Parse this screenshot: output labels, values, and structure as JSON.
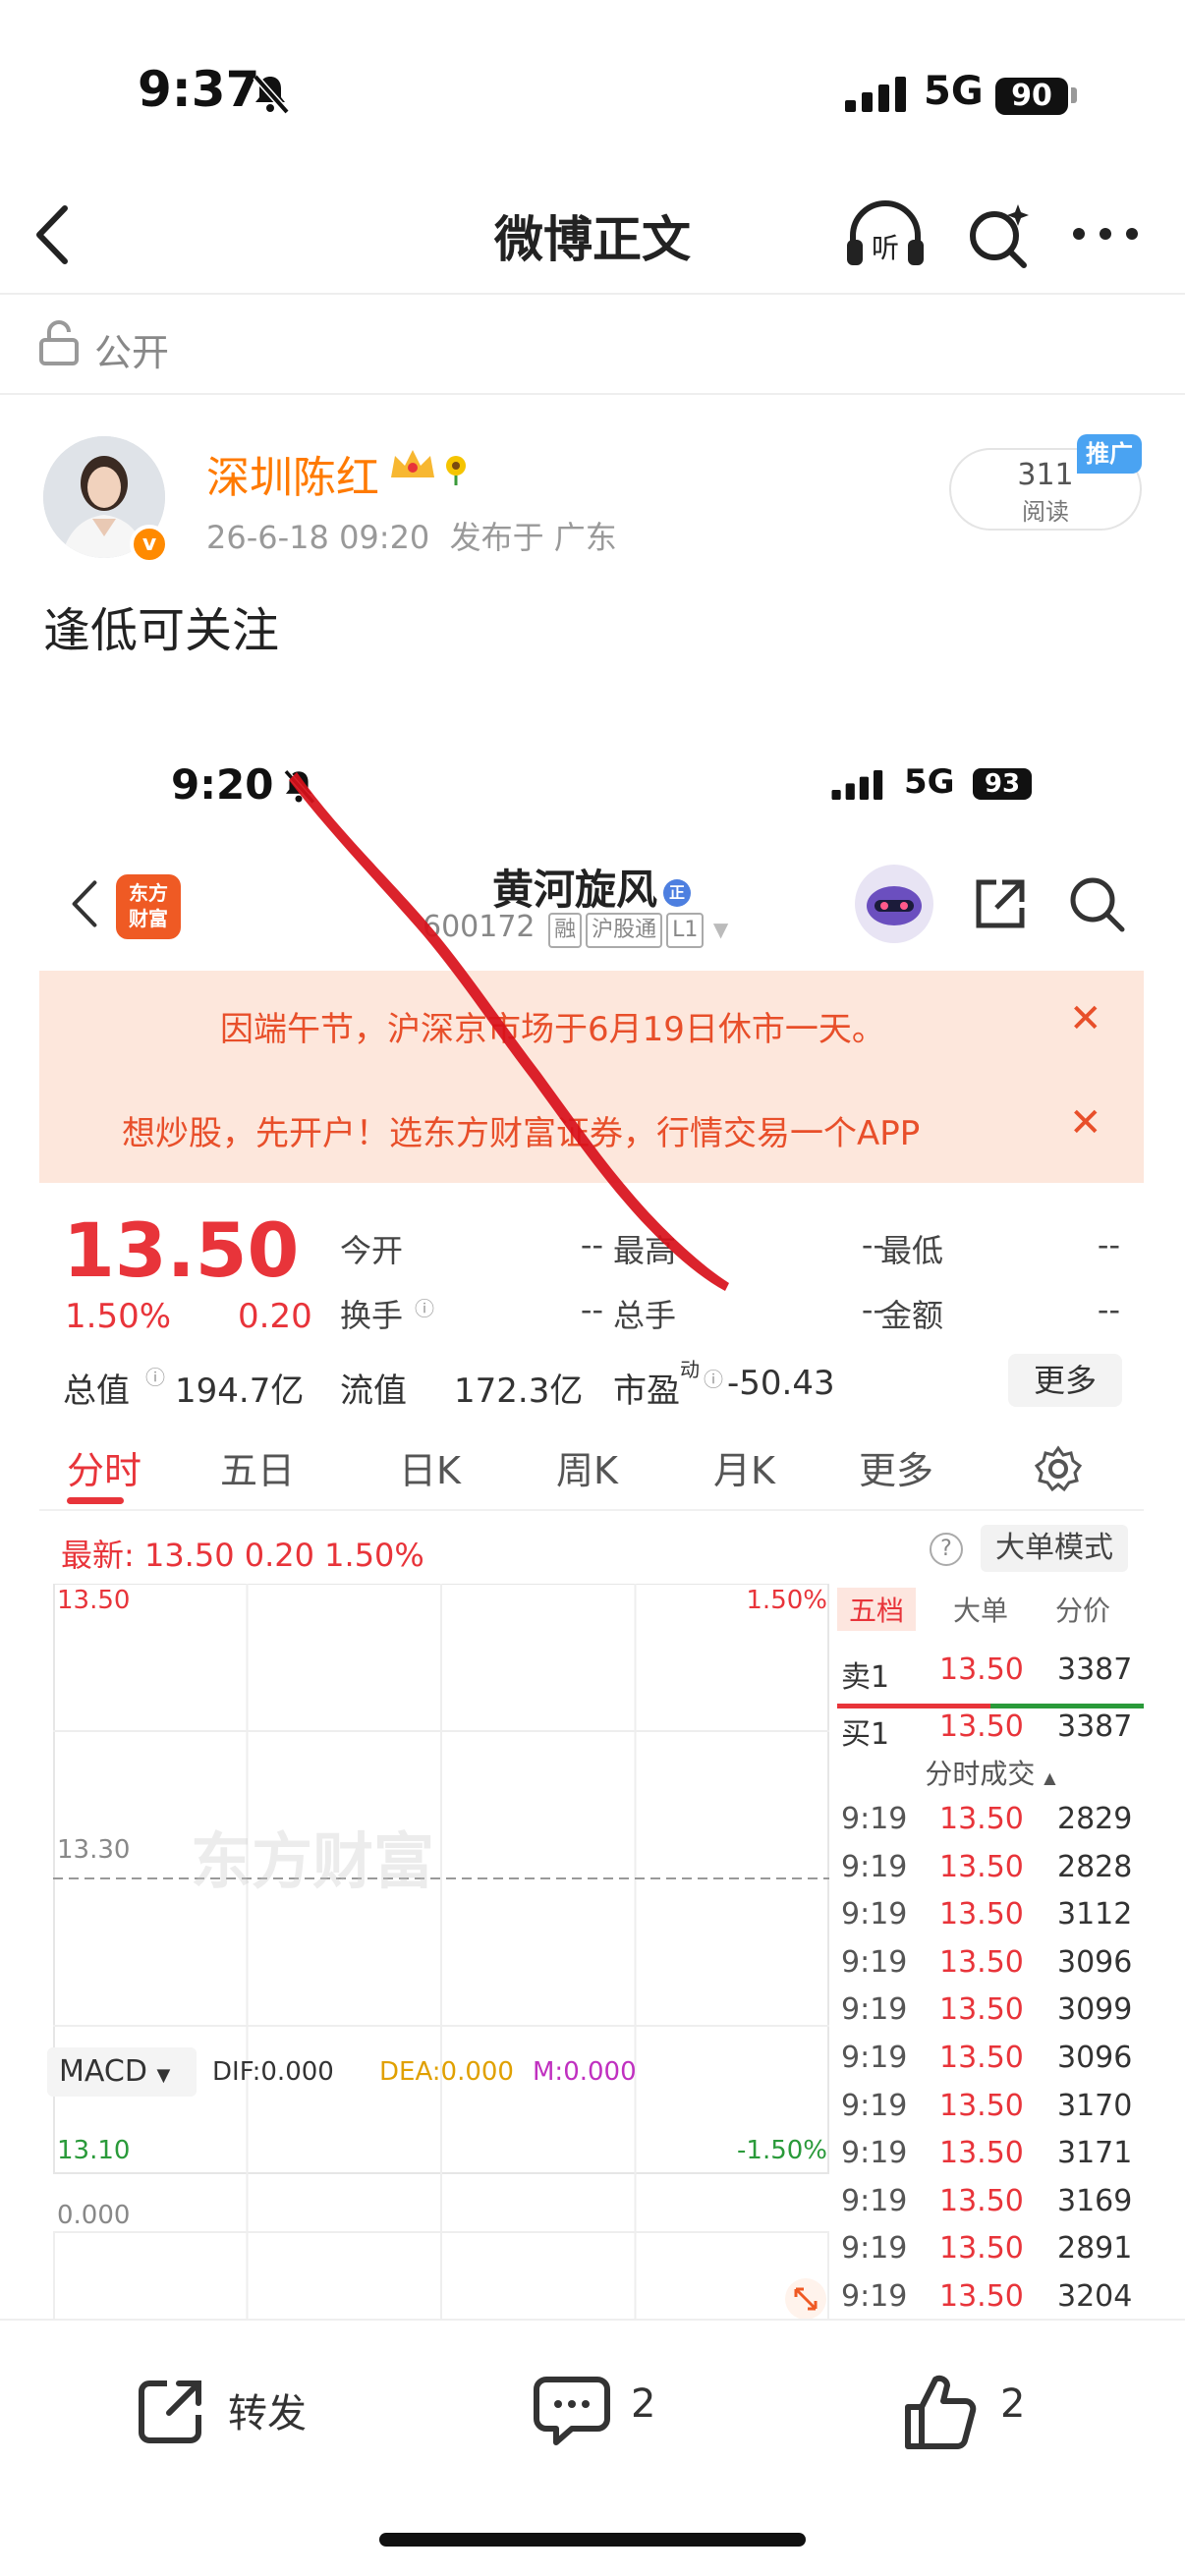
{
  "status_bar": {
    "time": "9:37",
    "network": "5G",
    "battery": "90"
  },
  "nav": {
    "title": "微博正文"
  },
  "visibility": {
    "label": "公开"
  },
  "author": {
    "name": "深圳陈红",
    "verified_mark": "v",
    "timestamp": "26-6-18 09:20",
    "location": "发布于 广东",
    "reads_count": "311",
    "reads_label": "阅读",
    "promo_tag": "推广"
  },
  "post": {
    "text": "逢低可关注"
  },
  "screenshot": {
    "status_bar": {
      "time": "9:20",
      "network": "5G",
      "battery": "93"
    },
    "app_logo": "东方\n财富",
    "stock": {
      "name": "黄河旋风",
      "code": "600172",
      "tags": [
        "融",
        "沪股通",
        "L1"
      ],
      "name_badge": "正"
    },
    "notices": [
      "因端午节，沪深京市场于6月19日休市一天。",
      "想炒股，先开户！选东方财富证券，行情交易一个APP"
    ],
    "quote": {
      "price": "13.50",
      "change_pct": "1.50%",
      "change": "0.20",
      "fields": [
        {
          "label": "今开",
          "value": "--"
        },
        {
          "label": "最高",
          "value": "--"
        },
        {
          "label": "最低",
          "value": "--"
        },
        {
          "label": "换手",
          "value": "--"
        },
        {
          "label": "总手",
          "value": "--"
        },
        {
          "label": "金额",
          "value": "--"
        }
      ],
      "total_value_label": "总值",
      "total_value": "194.7亿",
      "float_value_label": "流值",
      "float_value": "172.3亿",
      "pe_label": "市盈",
      "pe_sup": "动",
      "pe_value": "-50.43",
      "more_button": "更多"
    },
    "tabs": [
      "分时",
      "五日",
      "日K",
      "周K",
      "月K",
      "更多"
    ],
    "active_tab": "分时",
    "latest": {
      "text": "最新: 13.50  0.20  1.50%",
      "help": "?",
      "mode_button": "大单模式"
    },
    "chart_data": {
      "type": "line",
      "y_left_labels": [
        "13.50",
        "13.30",
        "13.10"
      ],
      "y_right_labels": [
        "1.50%",
        "-1.50%"
      ],
      "ylim": [
        13.1,
        13.5
      ],
      "reference_line": 13.3,
      "watermark": "东方财富",
      "series": []
    },
    "macd": {
      "selector": "MACD",
      "dif": "DIF:0.000",
      "dea": "DEA:0.000",
      "m": "M:0.000",
      "zero_label": "0.000"
    },
    "order_book": {
      "tabs": [
        "五档",
        "大单",
        "分价"
      ],
      "sell1": {
        "label": "卖1",
        "price": "13.50",
        "volume": "3387"
      },
      "buy1": {
        "label": "买1",
        "price": "13.50",
        "volume": "3387"
      },
      "trades_header": "分时成交",
      "trades": [
        {
          "time": "9:19",
          "price": "13.50",
          "volume": "2829"
        },
        {
          "time": "9:19",
          "price": "13.50",
          "volume": "2828"
        },
        {
          "time": "9:19",
          "price": "13.50",
          "volume": "3112"
        },
        {
          "time": "9:19",
          "price": "13.50",
          "volume": "3096"
        },
        {
          "time": "9:19",
          "price": "13.50",
          "volume": "3099"
        },
        {
          "time": "9:19",
          "price": "13.50",
          "volume": "3096"
        },
        {
          "time": "9:19",
          "price": "13.50",
          "volume": "3170"
        },
        {
          "time": "9:19",
          "price": "13.50",
          "volume": "3171"
        },
        {
          "time": "9:19",
          "price": "13.50",
          "volume": "3169"
        },
        {
          "time": "9:19",
          "price": "13.50",
          "volume": "2891"
        },
        {
          "time": "9:19",
          "price": "13.50",
          "volume": "3204"
        }
      ]
    },
    "colors": {
      "up": "#e8343a",
      "down": "#2a9a3a",
      "accent": "#ef5a24",
      "annotation": "#d8101a"
    }
  },
  "actions": {
    "repost_label": "转发",
    "comment_count": "2",
    "like_count": "2"
  },
  "icons": [
    "back-arrow-icon",
    "listen-icon",
    "ai-search-icon",
    "more-icon",
    "lock-icon",
    "repost-icon",
    "comment-icon",
    "like-icon",
    "gear-icon",
    "share-icon",
    "search-icon",
    "mute-bell-icon",
    "signal-icon"
  ]
}
